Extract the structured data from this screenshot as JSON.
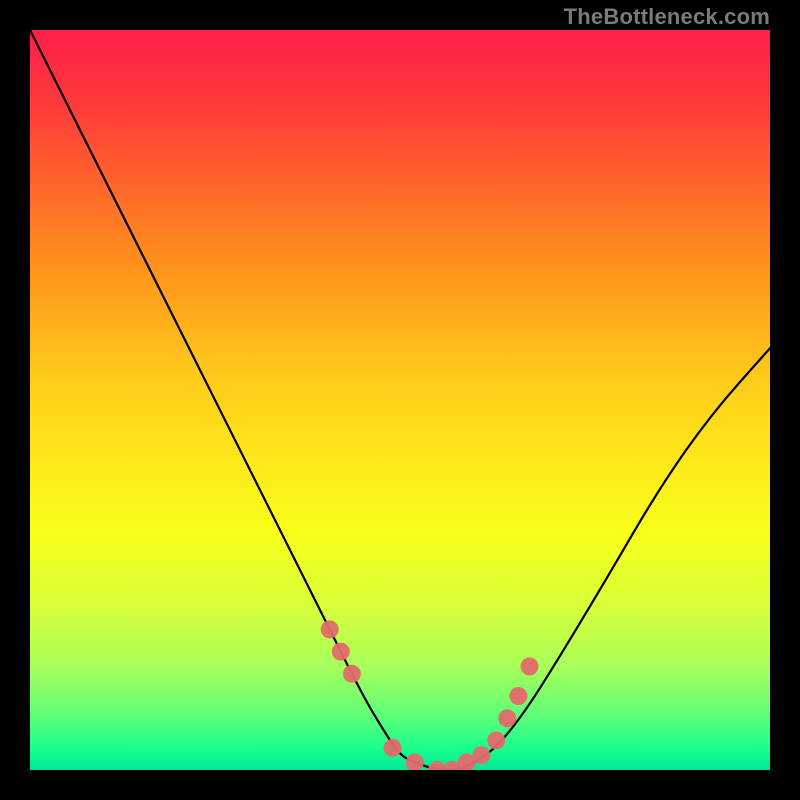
{
  "watermark": "TheBottleneck.com",
  "chart_data": {
    "type": "line",
    "title": "",
    "xlabel": "",
    "ylabel": "",
    "xlim": [
      0,
      100
    ],
    "ylim": [
      0,
      100
    ],
    "grid_visible": false,
    "series": [
      {
        "name": "bottleneck-curve",
        "x": [
          0,
          5,
          10,
          15,
          20,
          25,
          30,
          35,
          40,
          45,
          48,
          50,
          52,
          55,
          58,
          60,
          63,
          67,
          72,
          78,
          85,
          92,
          100
        ],
        "y": [
          100,
          90,
          80,
          70,
          60,
          50,
          40,
          30,
          20,
          10,
          5,
          2,
          1,
          0,
          0,
          1,
          3,
          8,
          16,
          26,
          38,
          48,
          57
        ]
      }
    ],
    "markers": {
      "name": "highlight-dots",
      "color": "#e36a6c",
      "radius_px": 9,
      "x": [
        40.5,
        42,
        43.5,
        49,
        52,
        55,
        57,
        59,
        61,
        63,
        64.5,
        66,
        67.5
      ],
      "y": [
        19,
        16,
        13,
        3,
        1,
        0,
        0,
        1,
        2,
        4,
        7,
        10,
        14
      ]
    },
    "background": {
      "type": "vertical-gradient",
      "stops": [
        {
          "pct": 0,
          "color": "#ff1f4a"
        },
        {
          "pct": 50,
          "color": "#ffd81a"
        },
        {
          "pct": 100,
          "color": "#00e89a"
        }
      ]
    }
  }
}
